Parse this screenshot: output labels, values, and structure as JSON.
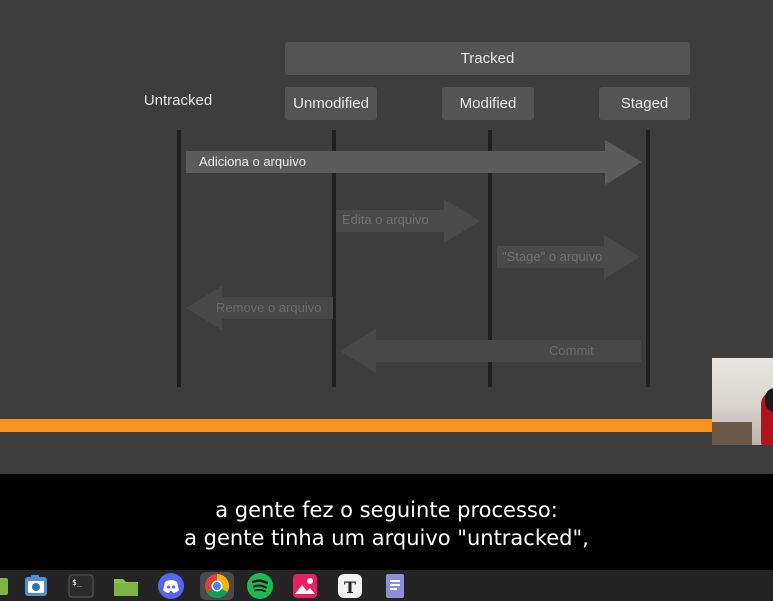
{
  "slide": {
    "tracked_label": "Tracked",
    "untracked_label": "Untracked",
    "states": [
      "Unmodified",
      "Modified",
      "Staged"
    ],
    "arrows": {
      "add": "Adiciona o arquivo",
      "edit": "Edita o arquivo",
      "stage": "\"Stage\" o arquivo",
      "remove": "Remove o arquivo",
      "commit": "Commit"
    }
  },
  "subtitles": {
    "line1": "a gente fez o seguinte processo:",
    "line2": "a gente tinha um arquivo \"untracked\","
  },
  "taskbar": {
    "apps": [
      "files-green",
      "screenshot",
      "terminal",
      "folder",
      "discord",
      "chrome",
      "spotify",
      "image-viewer",
      "typora",
      "text-editor"
    ],
    "active_app": "chrome"
  },
  "colors": {
    "orange": "#f7931e",
    "slide_bg": "#3d3d3d",
    "header_box": "#545454"
  }
}
